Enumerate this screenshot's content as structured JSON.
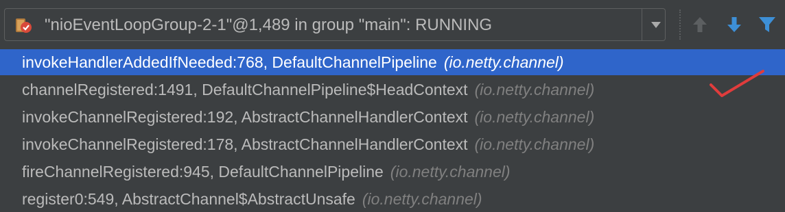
{
  "thread_selector": {
    "value": "\"nioEventLoopGroup-2-1\"@1,489 in group \"main\": RUNNING",
    "icon": "thread-running-icon"
  },
  "toolbar": {
    "up_icon": "arrow-up-icon",
    "down_icon": "arrow-down-icon",
    "filter_icon": "filter-icon"
  },
  "frames": [
    {
      "method": "invokeHandlerAddedIfNeeded:768, DefaultChannelPipeline",
      "package": "(io.netty.channel)",
      "selected": true
    },
    {
      "method": "channelRegistered:1491, DefaultChannelPipeline$HeadContext",
      "package": "(io.netty.channel)",
      "selected": false
    },
    {
      "method": "invokeChannelRegistered:192, AbstractChannelHandlerContext",
      "package": "(io.netty.channel)",
      "selected": false
    },
    {
      "method": "invokeChannelRegistered:178, AbstractChannelHandlerContext",
      "package": "(io.netty.channel)",
      "selected": false
    },
    {
      "method": "fireChannelRegistered:945, DefaultChannelPipeline",
      "package": "(io.netty.channel)",
      "selected": false
    },
    {
      "method": "register0:549, AbstractChannel$AbstractUnsafe",
      "package": "(io.netty.channel)",
      "selected": false
    }
  ],
  "colors": {
    "background": "#3c3f41",
    "selection": "#2f65ca",
    "accent_blue": "#3d8fd6",
    "annotation_red": "#e03c3c"
  }
}
